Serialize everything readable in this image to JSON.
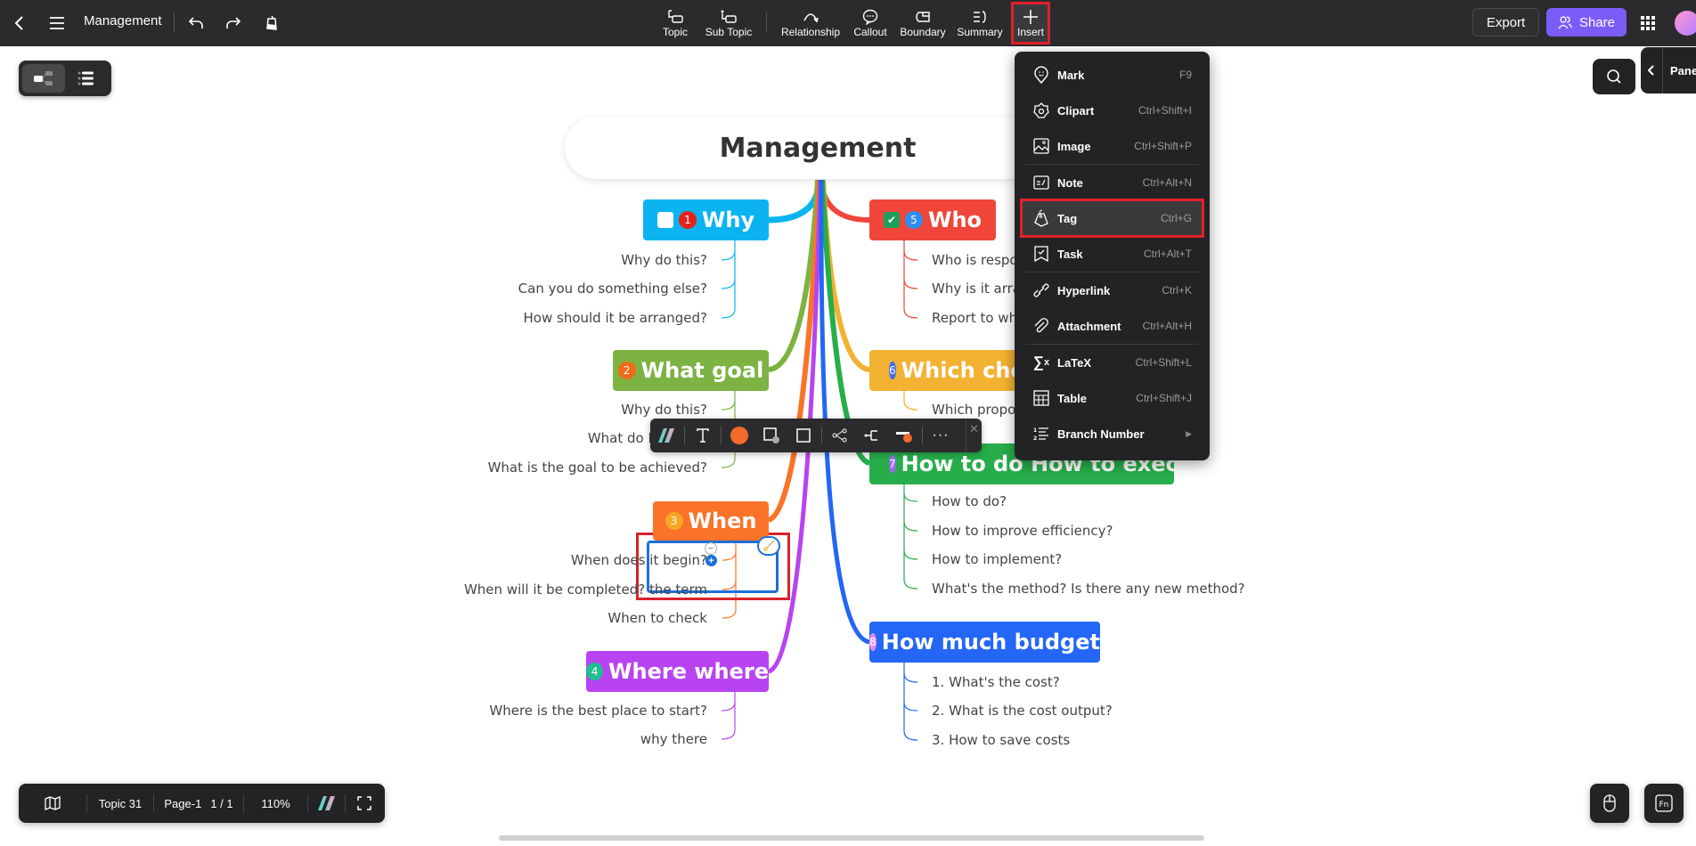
{
  "topbar": {
    "title": "Management",
    "tools": [
      {
        "id": "topic",
        "label": "Topic",
        "icon": "topic-icon"
      },
      {
        "id": "subtopic",
        "label": "Sub Topic",
        "icon": "subtopic-icon"
      },
      {
        "id": "relationship",
        "label": "Relationship",
        "icon": "relationship-icon"
      },
      {
        "id": "callout",
        "label": "Callout",
        "icon": "callout-icon"
      },
      {
        "id": "boundary",
        "label": "Boundary",
        "icon": "boundary-icon"
      },
      {
        "id": "summary",
        "label": "Summary",
        "icon": "summary-icon"
      },
      {
        "id": "insert",
        "label": "Insert",
        "icon": "plus-icon"
      }
    ],
    "export_label": "Export",
    "share_label": "Share"
  },
  "side": {
    "panel_label": "Panel"
  },
  "mindmap": {
    "root": "Management",
    "branches": [
      {
        "title": "Why",
        "number": "1",
        "color": "#0bb4f0",
        "num_color": "#e5211b",
        "checkbox": "unchecked",
        "children": [
          "Why do this?",
          "Can you do something else?",
          "How should it be arranged?"
        ]
      },
      {
        "title": "What goal",
        "number": "2",
        "color": "#7cb342",
        "num_color": "#f06a1a",
        "children": [
          "Why do this?",
          "What do I need to",
          "What is the goal to be achieved?"
        ]
      },
      {
        "title": "When",
        "number": "3",
        "color": "#fa7329",
        "num_color": "#f5a623",
        "children": [
          "When does it begin?",
          "When will it be completed? the term",
          "When to check"
        ]
      },
      {
        "title": "Where where",
        "number": "4",
        "color": "#b744f0",
        "num_color": "#1fbf8f",
        "children": [
          "Where is the best place to start?",
          "why there"
        ]
      },
      {
        "title": "Who",
        "number": "5",
        "color": "#f0463a",
        "num_color": "#2f8ef0",
        "checkbox": "checked",
        "children": [
          "Who is respon",
          "Why is it arran",
          "Report to who"
        ]
      },
      {
        "title": "Which choic",
        "number": "6",
        "color": "#f3b232",
        "num_color": "#3a6ef0",
        "children": [
          "Which propos"
        ]
      },
      {
        "title": "How to do How to execute",
        "number": "7",
        "color": "#27ae4a",
        "num_color": "#9b6cf0",
        "children": [
          "How to do?",
          "How to improve efficiency?",
          "How to implement?",
          "What's the method? Is there any new method?"
        ]
      },
      {
        "title": "How much budget",
        "number": "8",
        "color": "#2466f5",
        "num_color": "#e88ce8",
        "children": [
          "1. What's the cost?",
          "2. What is the cost output?",
          "3. How to save costs"
        ]
      }
    ]
  },
  "insert_menu": {
    "items": [
      {
        "label": "Mark",
        "shortcut": "F9",
        "icon": "mark-icon"
      },
      {
        "label": "Clipart",
        "shortcut": "Ctrl+Shift+I",
        "icon": "clipart-icon"
      },
      {
        "label": "Image",
        "shortcut": "Ctrl+Shift+P",
        "icon": "image-icon"
      },
      {
        "label": "Note",
        "shortcut": "Ctrl+Alt+N",
        "icon": "note-icon"
      },
      {
        "label": "Tag",
        "shortcut": "Ctrl+G",
        "icon": "tag-icon",
        "highlighted": true
      },
      {
        "label": "Task",
        "shortcut": "Ctrl+Alt+T",
        "icon": "task-icon"
      },
      {
        "label": "Hyperlink",
        "shortcut": "Ctrl+K",
        "icon": "hyperlink-icon"
      },
      {
        "label": "Attachment",
        "shortcut": "Ctrl+Alt+H",
        "icon": "attachment-icon"
      },
      {
        "label": "LaTeX",
        "shortcut": "Ctrl+Shift+L",
        "icon": "latex-icon"
      },
      {
        "label": "Table",
        "shortcut": "Ctrl+Shift+J",
        "icon": "table-icon"
      },
      {
        "label": "Branch Number",
        "shortcut": "",
        "icon": "branch-number-icon",
        "submenu": true
      }
    ]
  },
  "floating_toolbar": {
    "fill_color": "#f26b2a"
  },
  "bottombar": {
    "topic_count": "Topic 31",
    "page": "Page-1",
    "page_count": "1 / 1",
    "zoom": "110%"
  }
}
